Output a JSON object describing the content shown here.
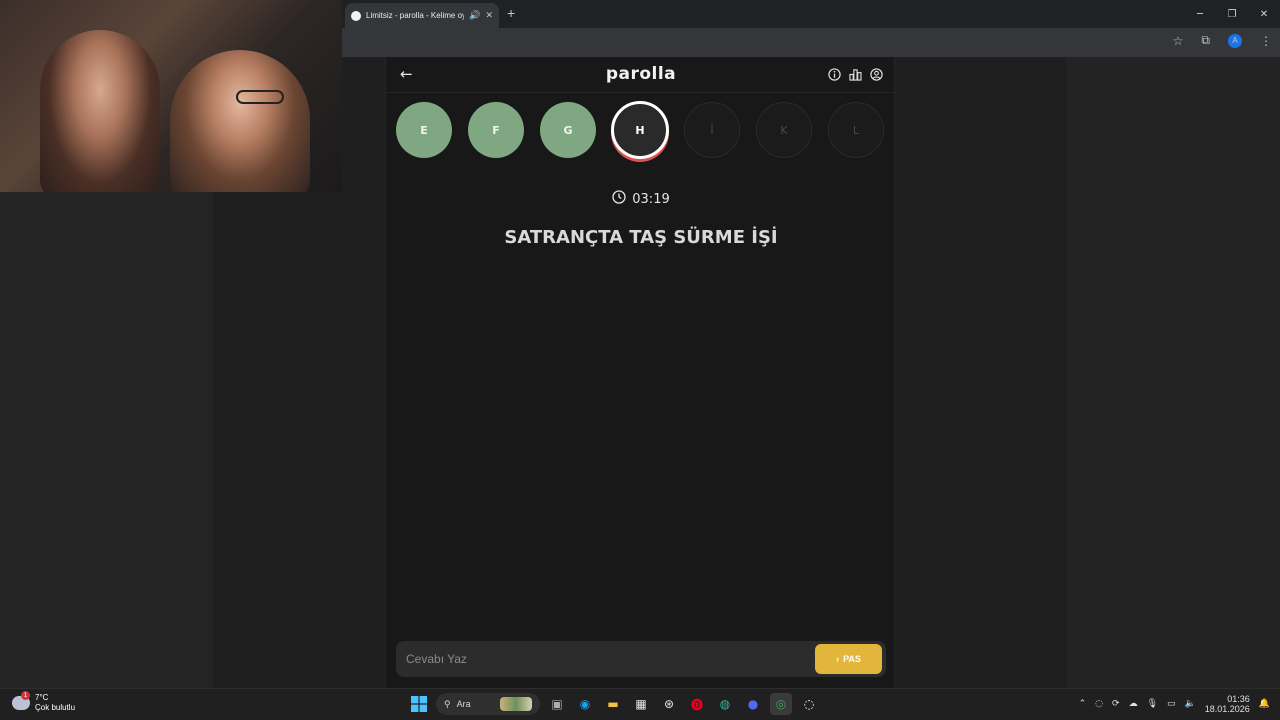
{
  "browser": {
    "tab_title": "Limitsiz - parolla - Kelime oyunu",
    "new_tab_symbol": "+",
    "window_controls": [
      "─",
      "❐",
      "✕"
    ]
  },
  "app": {
    "title": "parolla",
    "letters": [
      {
        "letter": "E",
        "state": "correct"
      },
      {
        "letter": "F",
        "state": "correct"
      },
      {
        "letter": "G",
        "state": "correct"
      },
      {
        "letter": "H",
        "state": "current"
      },
      {
        "letter": "İ",
        "state": "pending"
      },
      {
        "letter": "K",
        "state": "pending"
      },
      {
        "letter": "L",
        "state": "pending"
      }
    ],
    "timer": "03:19",
    "question": "SATRANÇTA TAŞ SÜRME İŞİ",
    "answer_placeholder": "Cevabı Yaz",
    "pass_label": "PAS"
  },
  "taskbar": {
    "weather_temp": "7°C",
    "weather_desc": "Çok bulutlu",
    "weather_badge": "1",
    "search_label": "Ara",
    "clock_time": "01:36",
    "clock_date": "18.01.2026"
  },
  "colors": {
    "correct": "#7fa882",
    "current_ring": "#ffffff",
    "current_accent": "#d9534f",
    "pass_button": "#e2b53b",
    "app_bg": "#181818"
  }
}
